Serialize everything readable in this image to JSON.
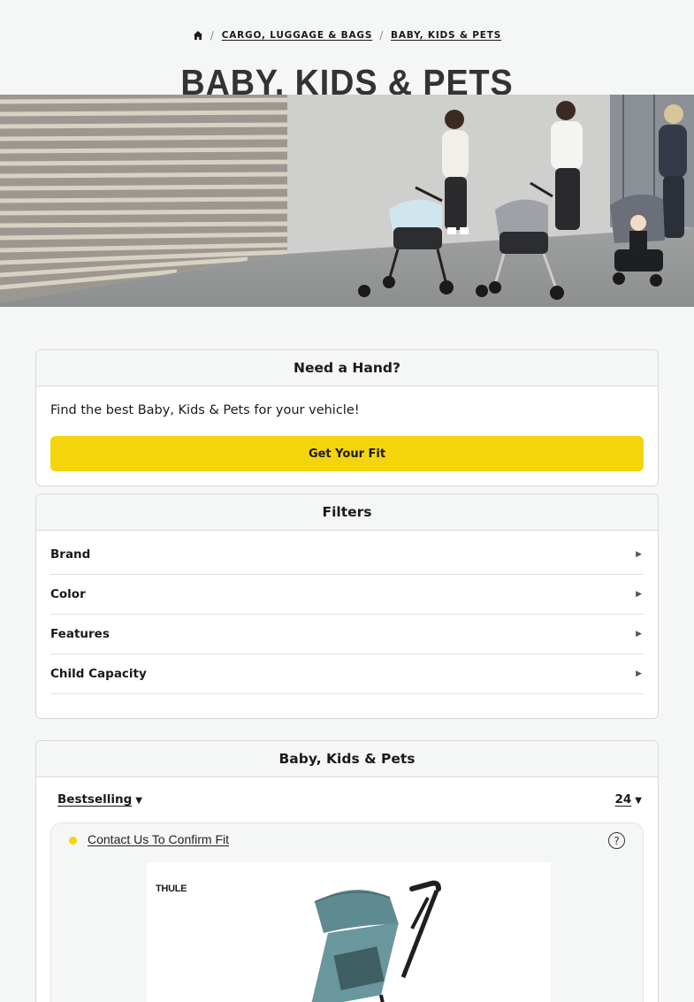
{
  "breadcrumb": {
    "items": [
      {
        "label": "CARGO, LUGGAGE & BAGS"
      },
      {
        "label": "BABY, KIDS & PETS"
      }
    ]
  },
  "page_title": "BABY, KIDS & PETS",
  "need_hand": {
    "title": "Need a Hand?",
    "text": "Find the best Baby, Kids & Pets for your vehicle!",
    "button": "Get Your Fit"
  },
  "filters": {
    "title": "Filters",
    "items": [
      {
        "label": "Brand"
      },
      {
        "label": "Color"
      },
      {
        "label": "Features"
      },
      {
        "label": "Child Capacity"
      }
    ]
  },
  "products": {
    "title": "Baby, Kids & Pets",
    "sort_label": "Bestselling",
    "per_page": "24",
    "card": {
      "fit_link": "Contact Us To Confirm Fit",
      "brand_logo": "THULE"
    }
  },
  "colors": {
    "accent_yellow": "#f4d50b",
    "background": "#f5f6f6"
  }
}
